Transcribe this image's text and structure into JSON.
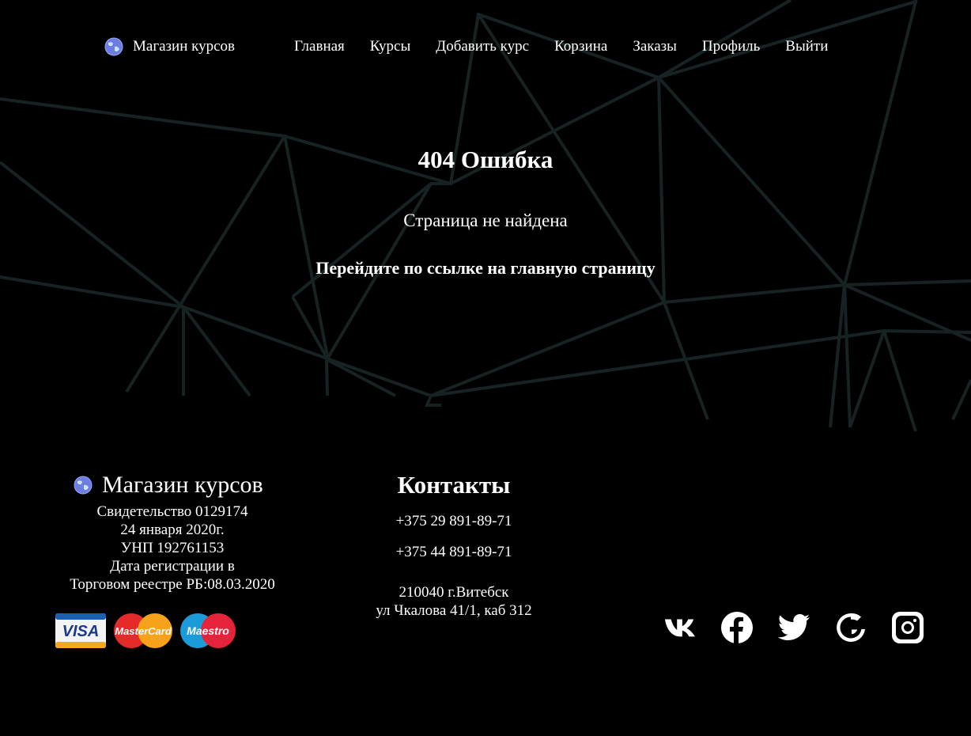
{
  "colors": {
    "background": "#000000",
    "text": "#ffffff",
    "network_lines": "#1a2626"
  },
  "header": {
    "brand": "Магазин курсов",
    "brand_icon": "globe-icon",
    "nav": [
      "Главная",
      "Курсы",
      "Добавить курс",
      "Корзина",
      "Заказы",
      "Профиль",
      "Выйти"
    ]
  },
  "main": {
    "title": "404 Ошибка",
    "subtitle": "Страница не найдена",
    "link": "Перейдите по ссылке на главную страницу"
  },
  "footer": {
    "brand": "Магазин курсов",
    "legal": [
      "Свидетельство 0129174",
      "24 января 2020г.",
      "УНП 192761153",
      "Дата регистрации в",
      "Торговом реестре РБ:08.03.2020"
    ],
    "payments": [
      "VISA",
      "MasterCard",
      "Maestro"
    ],
    "contacts_title": "Контакты",
    "phones": [
      "+375 29 891-89-71",
      "+375 44 891-89-71"
    ],
    "address": [
      "210040 г.Витебск",
      "ул Чкалова 41/1, каб 312"
    ],
    "social_icons": [
      "vk-icon",
      "facebook-icon",
      "twitter-icon",
      "google-icon",
      "instagram-icon"
    ]
  }
}
